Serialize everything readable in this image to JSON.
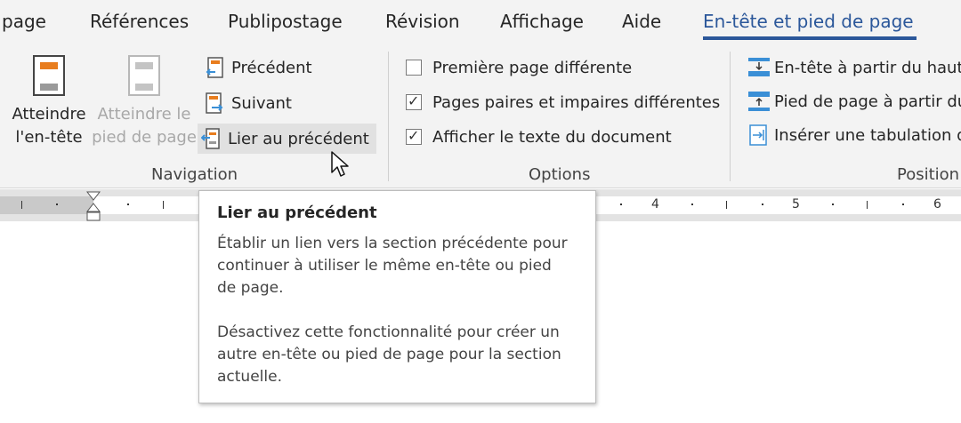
{
  "tabs": [
    {
      "label": "page",
      "active": false
    },
    {
      "label": "Références",
      "active": false
    },
    {
      "label": "Publipostage",
      "active": false
    },
    {
      "label": "Révision",
      "active": false
    },
    {
      "label": "Affichage",
      "active": false
    },
    {
      "label": "Aide",
      "active": false
    },
    {
      "label": "En-tête et pied de page",
      "active": true
    }
  ],
  "navigation": {
    "goto_header_line1": "Atteindre",
    "goto_header_line2": "l'en-tête",
    "goto_footer_line1": "Atteindre le",
    "goto_footer_line2": "pied de page",
    "previous": "Précédent",
    "next": "Suivant",
    "link_previous": "Lier au précédent",
    "group_label": "Navigation"
  },
  "options": {
    "items": [
      {
        "label": "Première page différente",
        "checked": false
      },
      {
        "label": "Pages paires et impaires différentes",
        "checked": true
      },
      {
        "label": "Afficher le texte du document",
        "checked": true
      }
    ],
    "group_label": "Options"
  },
  "position": {
    "header_from_top": "En-tête à partir du haut",
    "footer_from_bottom": "Pied de page à partir du",
    "insert_tab": "Insérer une tabulation d",
    "group_label": "Position"
  },
  "ruler": {
    "numbers": [
      "4",
      "5",
      "6"
    ]
  },
  "tooltip": {
    "title": "Lier au précédent",
    "para1_l1": "Établir un lien vers la section précédente pour",
    "para1_l2": "continuer à utiliser le même en-tête ou pied",
    "para1_l3": "de page.",
    "para2_l1": "Désactivez cette fonctionnalité pour créer un",
    "para2_l2": "autre en-tête ou pied de page pour la section",
    "para2_l3": "actuelle."
  },
  "colors": {
    "accent": "#2b579a",
    "orange": "#e87d1e",
    "blue_icon": "#3a8fd6"
  }
}
